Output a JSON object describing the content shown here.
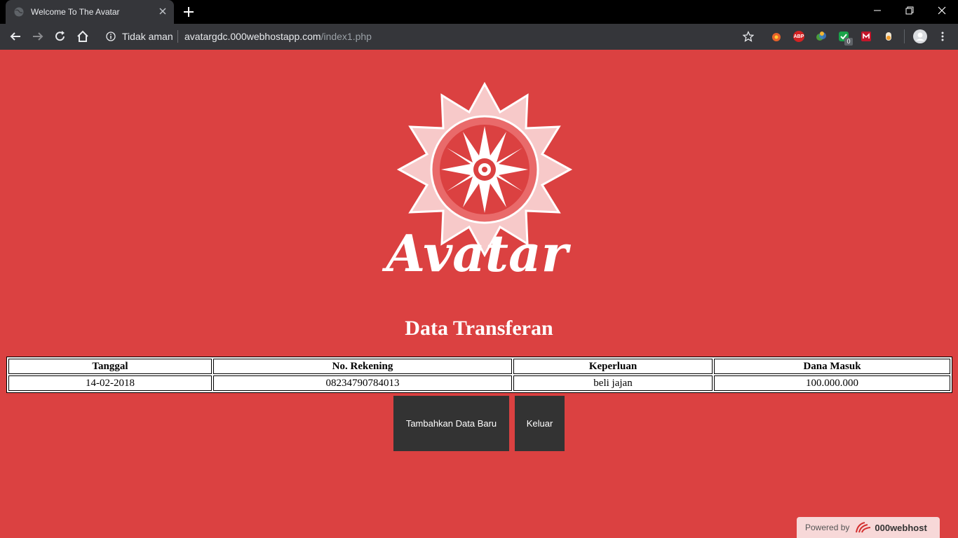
{
  "browser": {
    "tab_title": "Welcome To The Avatar",
    "security_label": "Tidak aman",
    "url_host": "avatargdc.000webhostapp.com",
    "url_path": "/index1.php",
    "extension_badge": "0",
    "abp_label": "ABP"
  },
  "page": {
    "logo_text": "Avatar",
    "title": "Data Transferan",
    "table": {
      "headers": [
        "Tanggal",
        "No. Rekening",
        "Keperluan",
        "Dana Masuk"
      ],
      "rows": [
        [
          "14-02-2018",
          "08234790784013",
          "beli jajan",
          "100.000.000"
        ]
      ]
    },
    "buttons": {
      "add": "Tambahkan Data Baru",
      "logout": "Keluar"
    },
    "footer": {
      "powered_by": "Powered by",
      "brand": "000webhost"
    },
    "colors": {
      "background": "#db4141",
      "button": "#333333",
      "accent": "#ffffff"
    }
  }
}
